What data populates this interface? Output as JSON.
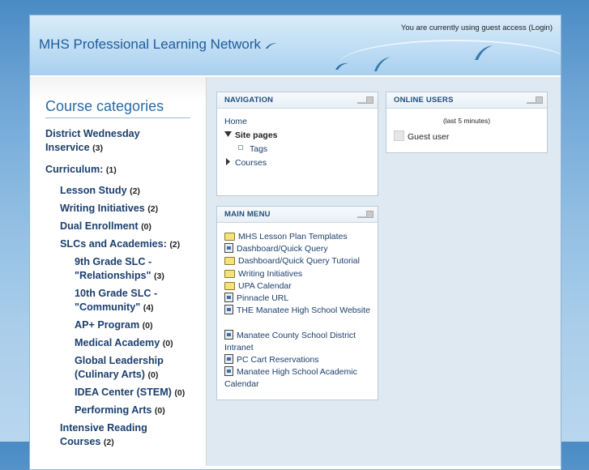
{
  "header": {
    "site_title": "MHS Professional Learning Network",
    "login_prefix": "You are currently using guest access (",
    "login_link": "Login",
    "login_suffix": ")"
  },
  "categories": {
    "title": "Course categories",
    "items": [
      {
        "name": "District Wednesday Inservice",
        "count": "(3)"
      },
      {
        "name": "Curriculum:",
        "count": "(1)"
      },
      {
        "name": "Lesson Study",
        "count": "(2)"
      },
      {
        "name": "Writing Initiatives",
        "count": "(2)"
      },
      {
        "name": "Dual Enrollment",
        "count": "(0)"
      },
      {
        "name": "SLCs and Academies:",
        "count": "(2)"
      },
      {
        "name": "9th Grade SLC - \"Relationships\"",
        "count": "(3)"
      },
      {
        "name": "10th Grade SLC - \"Community\"",
        "count": "(4)"
      },
      {
        "name": "AP+ Program",
        "count": "(0)"
      },
      {
        "name": "Medical Academy",
        "count": "(0)"
      },
      {
        "name": "Global Leadership (Culinary Arts)",
        "count": "(0)"
      },
      {
        "name": "IDEA Center (STEM)",
        "count": "(0)"
      },
      {
        "name": "Performing Arts",
        "count": "(0)"
      },
      {
        "name": "Intensive Reading Courses",
        "count": "(2)"
      }
    ]
  },
  "navigation": {
    "title": "NAVIGATION",
    "home": "Home",
    "site_pages": "Site pages",
    "tags": "Tags",
    "courses": "Courses"
  },
  "main_menu": {
    "title": "MAIN MENU",
    "items": [
      {
        "label": "MHS Lesson Plan Templates",
        "icon": "folder-icon"
      },
      {
        "label": "Dashboard/Quick Query",
        "icon": "document-icon"
      },
      {
        "label": "Dashboard/Quick Query Tutorial",
        "icon": "folder-icon"
      },
      {
        "label": "Writing Initiatives",
        "icon": "folder-icon"
      },
      {
        "label": "UPA Calendar",
        "icon": "folder-icon"
      },
      {
        "label": "Pinnacle URL",
        "icon": "document-icon"
      },
      {
        "label": "THE Manatee High School Website",
        "icon": "document-icon"
      },
      {
        "label": "Manatee County School District Intranet",
        "icon": "document-icon"
      },
      {
        "label": "PC Cart Reservations",
        "icon": "document-icon"
      },
      {
        "label": "Manatee High School Academic Calendar",
        "icon": "document-icon"
      }
    ]
  },
  "online_users": {
    "title": "ONLINE USERS",
    "note": "(last 5 minutes)",
    "user": "Guest user"
  }
}
